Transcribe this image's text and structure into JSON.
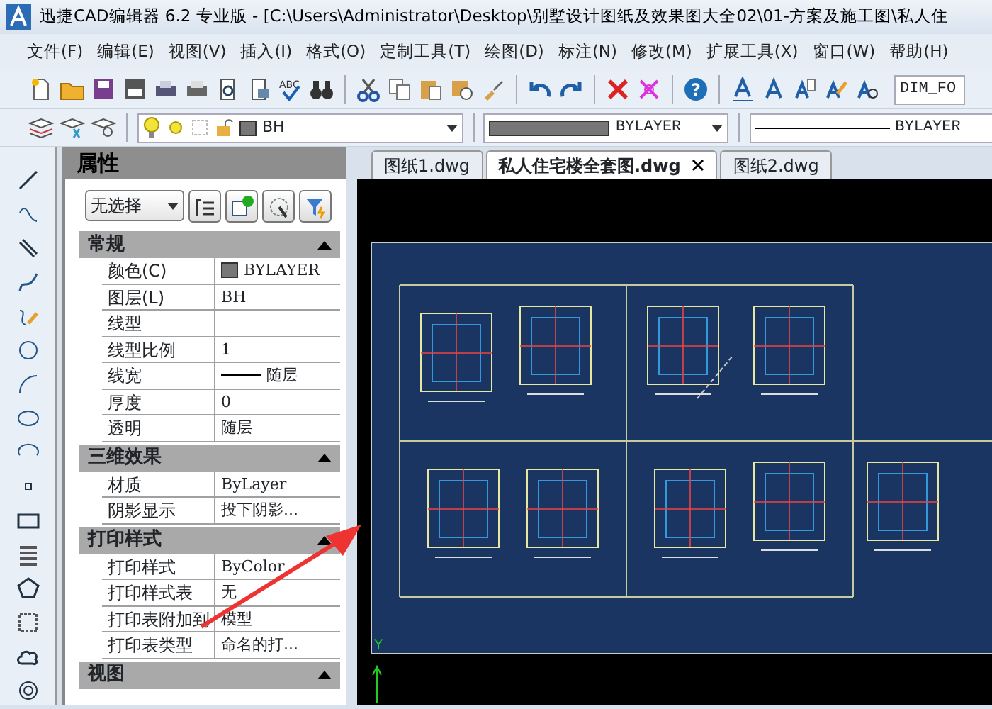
{
  "window": {
    "title": "迅捷CAD编辑器 6.2 专业版  - [C:\\Users\\Administrator\\Desktop\\别墅设计图纸及效果图大全02\\01-方案及施工图\\私人住"
  },
  "menu": [
    "文件(F)",
    "编辑(E)",
    "视图(V)",
    "插入(I)",
    "格式(O)",
    "定制工具(T)",
    "绘图(D)",
    "标注(N)",
    "修改(M)",
    "扩展工具(X)",
    "窗口(W)",
    "帮助(H)"
  ],
  "toolbar": {
    "spell_label": "ABC",
    "help_label": "?",
    "text_style": "DIM_FO"
  },
  "layer_bar": {
    "layer": "BH",
    "color_label": "BYLAYER",
    "linetype": "BYLAYER"
  },
  "properties": {
    "title": "属性",
    "selection": "无选择",
    "sections": [
      {
        "title": "常规",
        "expanded": true,
        "rows": [
          {
            "name": "颜色(C)",
            "value": "BYLAYER",
            "kind": "swatch"
          },
          {
            "name": "图层(L)",
            "value": "BH",
            "kind": "text"
          },
          {
            "name": "线型",
            "value": "",
            "kind": "text"
          },
          {
            "name": "线型比例",
            "value": "1",
            "kind": "text"
          },
          {
            "name": "线宽",
            "value": "随层",
            "kind": "lineweight"
          },
          {
            "name": "厚度",
            "value": "0",
            "kind": "text"
          },
          {
            "name": "透明",
            "value": "随层",
            "kind": "text"
          }
        ]
      },
      {
        "title": "三维效果",
        "expanded": true,
        "rows": [
          {
            "name": "材质",
            "value": "ByLayer",
            "kind": "text"
          },
          {
            "name": "阴影显示",
            "value": "投下阴影...",
            "kind": "text"
          }
        ]
      },
      {
        "title": "打印样式",
        "expanded": true,
        "rows": [
          {
            "name": "打印样式",
            "value": "ByColor",
            "kind": "text"
          },
          {
            "name": "打印样式表",
            "value": "无",
            "kind": "text"
          },
          {
            "name": "打印表附加到",
            "value": "模型",
            "kind": "text"
          },
          {
            "name": "打印表类型",
            "value": "命名的打...",
            "kind": "text"
          }
        ]
      },
      {
        "title": "视图",
        "expanded": true
      }
    ]
  },
  "tabs": [
    {
      "label": "图纸1.dwg",
      "selected": false
    },
    {
      "label": "私人住宅楼全套图.dwg",
      "selected": true
    },
    {
      "label": "图纸2.dwg",
      "selected": false
    }
  ],
  "canvas": {
    "axis_label": "Y"
  }
}
